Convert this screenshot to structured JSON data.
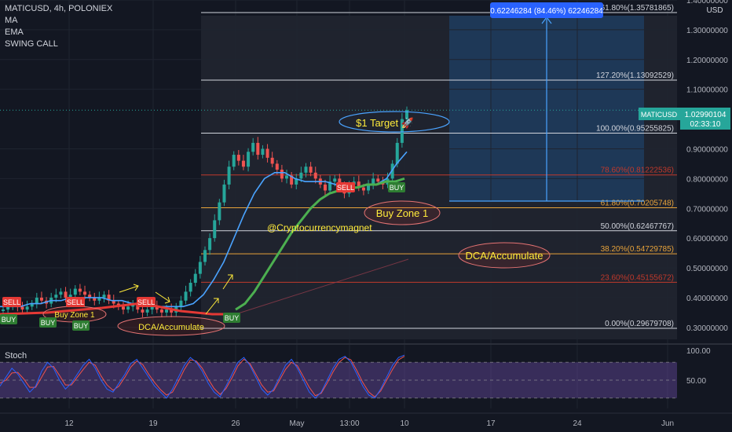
{
  "header": {
    "symbol_line": "MATICUSD, 4h, POLONIEX",
    "indicators": [
      "MA",
      "EMA",
      "SWING CALL"
    ]
  },
  "price_axis": {
    "currency": "USD",
    "ticks": [
      "1.40000000",
      "1.30000000",
      "1.20000000",
      "1.10000000",
      "0.90000000",
      "0.80000000",
      "0.70000000",
      "0.60000000",
      "0.50000000",
      "0.40000000",
      "0.30000000"
    ],
    "tick_values": [
      1.4,
      1.3,
      1.2,
      1.1,
      0.9,
      0.8,
      0.7,
      0.6,
      0.5,
      0.4,
      0.3
    ],
    "last_price_symbol": "MATICUSD",
    "last_price": "1.02990104",
    "countdown": "02:33:10",
    "last_value": 1.0299
  },
  "time_axis": {
    "labels": [
      "12",
      "19",
      "26",
      "May",
      "13:00",
      "10",
      "17",
      "24",
      "Jun"
    ]
  },
  "stoch_pane": {
    "label": "Stoch",
    "ticks": [
      "100.00",
      "50.00"
    ]
  },
  "colors": {
    "background": "#131722",
    "candle_up": "#26a69a",
    "candle_down": "#ef5350",
    "ma": "#4aa3ff",
    "ema": "#4caf50",
    "fib_white": "#ffffff",
    "fib_red": "#c0392b",
    "fib_orange": "#e8a33a",
    "stoch_k": "#2962ff",
    "stoch_d": "#ef5350",
    "stoch_band": "#7e57c2",
    "target_box": "#1e4b7a",
    "annotation_yellow": "#ffeb3b"
  },
  "fib_levels": [
    {
      "label": "161.80%(1.35781865)",
      "value": 1.35781865,
      "color": "white"
    },
    {
      "label": "127.20%(1.13092529)",
      "value": 1.13092529,
      "color": "white"
    },
    {
      "label": "100.00%(0.95255825)",
      "value": 0.95255825,
      "color": "white"
    },
    {
      "label": "78.60%(0.81222536)",
      "value": 0.81222536,
      "color": "red"
    },
    {
      "label": "61.80%(0.70205748)",
      "value": 0.70205748,
      "color": "orange"
    },
    {
      "label": "50.00%(0.62467767)",
      "value": 0.62467767,
      "color": "white"
    },
    {
      "label": "38.20%(0.54729785)",
      "value": 0.54729785,
      "color": "orange"
    },
    {
      "label": "23.60%(0.45155672)",
      "value": 0.45155672,
      "color": "red"
    },
    {
      "label": "0.00%(0.29679708)",
      "value": 0.29679708,
      "color": "white"
    }
  ],
  "measure_label": "0.62246284 (84.46%) 62246284",
  "annotations": {
    "target": "$1 Target 🚀",
    "buy_zone_main": "Buy Zone 1",
    "buy_zone_left": "Buy Zone 1",
    "dca_right": "DCA/Accumulate",
    "dca_left": "DCA/Accumulate",
    "watermark": "@Cryptocurrencymagnet"
  },
  "signal_labels": {
    "sell": "SELL",
    "buy": "BUY"
  },
  "chart_data": {
    "type": "candlestick",
    "title": "MATICUSD, 4h, POLONIEX",
    "ylim": [
      0.26,
      1.4
    ],
    "x_labels": [
      "12",
      "19",
      "26",
      "May",
      "13:00",
      "10",
      "17",
      "24",
      "Jun"
    ],
    "close_series": [
      0.36,
      0.37,
      0.38,
      0.37,
      0.36,
      0.37,
      0.38,
      0.4,
      0.39,
      0.38,
      0.4,
      0.41,
      0.42,
      0.4,
      0.41,
      0.43,
      0.42,
      0.41,
      0.4,
      0.39,
      0.4,
      0.41,
      0.39,
      0.38,
      0.37,
      0.36,
      0.37,
      0.38,
      0.36,
      0.35,
      0.36,
      0.37,
      0.36,
      0.35,
      0.36,
      0.35,
      0.37,
      0.39,
      0.42,
      0.45,
      0.48,
      0.52,
      0.56,
      0.6,
      0.66,
      0.72,
      0.78,
      0.84,
      0.88,
      0.86,
      0.84,
      0.89,
      0.92,
      0.88,
      0.9,
      0.87,
      0.85,
      0.83,
      0.8,
      0.81,
      0.78,
      0.8,
      0.82,
      0.84,
      0.82,
      0.8,
      0.78,
      0.76,
      0.79,
      0.8,
      0.77,
      0.75,
      0.78,
      0.79,
      0.77,
      0.76,
      0.78,
      0.8,
      0.79,
      0.78,
      0.8,
      0.85,
      0.92,
      1.0,
      1.03
    ],
    "ma_series": [
      0.37,
      0.37,
      0.37,
      0.38,
      0.38,
      0.39,
      0.39,
      0.4,
      0.4,
      0.4,
      0.4,
      0.39,
      0.39,
      0.38,
      0.38,
      0.37,
      0.37,
      0.37,
      0.37,
      0.38,
      0.41,
      0.46,
      0.52,
      0.6,
      0.68,
      0.75,
      0.8,
      0.82,
      0.82,
      0.8,
      0.79,
      0.79,
      0.79,
      0.78,
      0.77,
      0.77,
      0.78,
      0.78,
      0.8,
      0.85,
      0.89
    ],
    "ema_series": [
      0.36,
      0.38,
      0.42,
      0.47,
      0.52,
      0.57,
      0.62,
      0.66,
      0.7,
      0.73,
      0.75,
      0.76,
      0.77,
      0.77,
      0.78,
      0.78,
      0.79,
      0.79,
      0.8
    ],
    "stoch_k": [
      40,
      55,
      70,
      60,
      45,
      30,
      40,
      65,
      80,
      70,
      50,
      35,
      45,
      60,
      75,
      85,
      70,
      50,
      35,
      30,
      45,
      60,
      78,
      85,
      70,
      55,
      40,
      30,
      20,
      35,
      55,
      75,
      88,
      80,
      65,
      45,
      30,
      22,
      40,
      60,
      80,
      88,
      75,
      55,
      35,
      25,
      35,
      55,
      75,
      85,
      70,
      50,
      30,
      20,
      30,
      50,
      70,
      85,
      90,
      80,
      60,
      40,
      25,
      20,
      35,
      55,
      75,
      88,
      92
    ],
    "stoch_d": [
      45,
      50,
      62,
      63,
      52,
      38,
      38,
      55,
      72,
      73,
      58,
      42,
      42,
      55,
      68,
      80,
      75,
      57,
      42,
      33,
      40,
      55,
      72,
      82,
      76,
      60,
      46,
      34,
      25,
      30,
      48,
      68,
      84,
      82,
      70,
      52,
      36,
      26,
      36,
      54,
      74,
      85,
      78,
      60,
      42,
      30,
      32,
      50,
      68,
      80,
      74,
      56,
      38,
      24,
      28,
      45,
      64,
      80,
      88,
      84,
      66,
      46,
      30,
      22,
      32,
      50,
      68,
      84,
      90
    ]
  }
}
